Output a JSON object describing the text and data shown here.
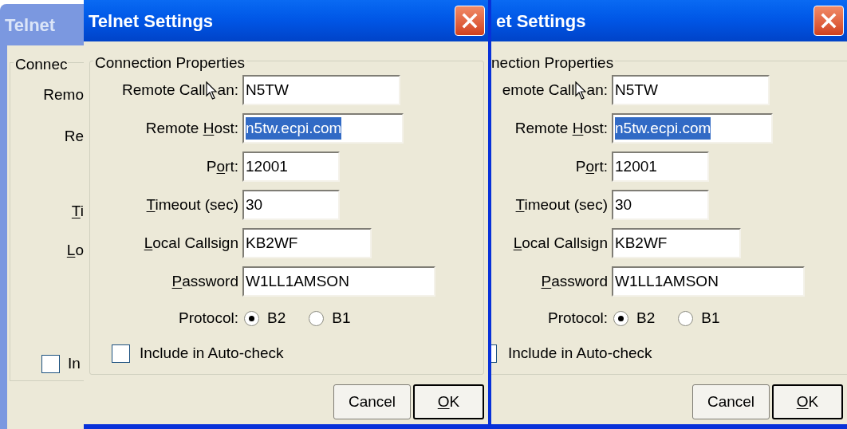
{
  "windows": [
    {
      "kind": "edge",
      "active": false,
      "title": "Telnet",
      "group_title": "Connec",
      "labels": [
        {
          "pre": "Remo"
        },
        {
          "pre": "Re"
        },
        {
          "key": "T",
          "post": "i"
        },
        {
          "key": "L",
          "post": "o"
        }
      ],
      "auto_check": {
        "label": "In",
        "checked": false
      }
    },
    {
      "kind": "dialog",
      "active": true,
      "title": "Telnet Settings",
      "group_title": "Connection Properties",
      "fields": [
        {
          "label": {
            "pre": "Remote Call",
            "pointer": true,
            "post": "an:"
          },
          "value": "N5TW",
          "selected": false
        },
        {
          "label": {
            "pre": "Remote ",
            "key": "H",
            "post": "ost:"
          },
          "value": "n5tw.ecpi.com",
          "selected": true
        },
        {
          "label": {
            "pre": "P",
            "key": "o",
            "post": "rt:"
          },
          "value": "12001",
          "selected": false
        },
        {
          "label": {
            "key": "T",
            "post": "imeout (sec)"
          },
          "value": "30",
          "selected": false
        },
        {
          "label": {
            "key": "L",
            "post": "ocal Callsign"
          },
          "value": "KB2WF",
          "selected": false
        },
        {
          "label": {
            "key": "P",
            "post": "assword"
          },
          "value": "W1LL1AMSON",
          "selected": false
        }
      ],
      "protocol": {
        "label": "Protocol:",
        "options": [
          {
            "label": "B2",
            "selected": true
          },
          {
            "label": "B1",
            "selected": false
          }
        ]
      },
      "auto_check": {
        "label": "Include in Auto-check",
        "checked": false
      },
      "buttons": [
        {
          "label": {
            "pre": "Cancel"
          },
          "default": false
        },
        {
          "label": {
            "key": "O",
            "post": "K"
          },
          "default": true
        }
      ]
    },
    {
      "kind": "dialog",
      "active": true,
      "title": "et Settings",
      "group_title": "nection Properties",
      "fields": [
        {
          "label": {
            "pre": "emote Call",
            "pointer": true,
            "post": "an:"
          },
          "value": "N5TW",
          "selected": false
        },
        {
          "label": {
            "pre": "Remote ",
            "key": "H",
            "post": "ost:"
          },
          "value": "n5tw.ecpi.com",
          "selected": true
        },
        {
          "label": {
            "pre": "P",
            "key": "o",
            "post": "rt:"
          },
          "value": "12001",
          "selected": false
        },
        {
          "label": {
            "key": "T",
            "post": "imeout (sec)"
          },
          "value": "30",
          "selected": false
        },
        {
          "label": {
            "key": "L",
            "post": "ocal Callsign"
          },
          "value": "KB2WF",
          "selected": false
        },
        {
          "label": {
            "key": "P",
            "post": "assword"
          },
          "value": "W1LL1AMSON",
          "selected": false
        }
      ],
      "protocol": {
        "label": "Protocol:",
        "options": [
          {
            "label": "B2",
            "selected": true
          },
          {
            "label": "B1",
            "selected": false
          }
        ]
      },
      "auto_check": {
        "label": "Include in Auto-check",
        "checked": false
      },
      "buttons": [
        {
          "label": {
            "pre": "Cancel"
          },
          "default": false
        },
        {
          "label": {
            "key": "O",
            "post": "K"
          },
          "default": true
        }
      ]
    }
  ]
}
